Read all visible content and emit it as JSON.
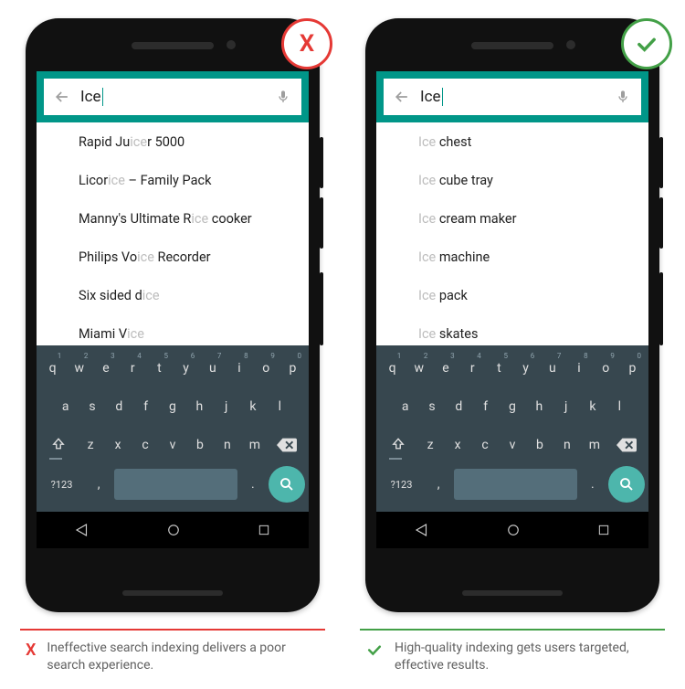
{
  "query": "Ice",
  "bad": {
    "suggestions": [
      {
        "pre": "Rapid Ju",
        "match": "ice",
        "post": "r 5000"
      },
      {
        "pre": "Licor",
        "match": "ice",
        "post": " – Family Pack"
      },
      {
        "pre": "Manny's Ultimate R",
        "match": "ice",
        "post": " cooker"
      },
      {
        "pre": "Philips Vo",
        "match": "ice",
        "post": " Recorder"
      },
      {
        "pre": "Six sided d",
        "match": "ice",
        "post": ""
      },
      {
        "pre": "Miami V",
        "match": "ice",
        "post": ""
      }
    ],
    "caption": "Ineffective search indexing delivers a poor search experience.",
    "badge": "X"
  },
  "good": {
    "suggestions": [
      {
        "pre": "",
        "match": "Ice",
        "post": " chest"
      },
      {
        "pre": "",
        "match": "Ice",
        "post": " cube tray"
      },
      {
        "pre": "",
        "match": "Ice",
        "post": " cream maker"
      },
      {
        "pre": "",
        "match": "Ice",
        "post": " machine"
      },
      {
        "pre": "",
        "match": "Ice",
        "post": " pack"
      },
      {
        "pre": "",
        "match": "Ice",
        "post": " skates"
      }
    ],
    "caption": "High-quality indexing gets users targeted, effective results.",
    "badge": "✓"
  },
  "keyboard": {
    "row1": [
      {
        "k": "q",
        "n": "1"
      },
      {
        "k": "w",
        "n": "2"
      },
      {
        "k": "e",
        "n": "3"
      },
      {
        "k": "r",
        "n": "4"
      },
      {
        "k": "t",
        "n": "5"
      },
      {
        "k": "y",
        "n": "6"
      },
      {
        "k": "u",
        "n": "7"
      },
      {
        "k": "i",
        "n": "8"
      },
      {
        "k": "o",
        "n": "9"
      },
      {
        "k": "p",
        "n": "0"
      }
    ],
    "row2": [
      "a",
      "s",
      "d",
      "f",
      "g",
      "h",
      "j",
      "k",
      "l"
    ],
    "row3": [
      "z",
      "x",
      "c",
      "v",
      "b",
      "n",
      "m"
    ],
    "sym": "?123",
    "comma": ",",
    "period": "."
  }
}
